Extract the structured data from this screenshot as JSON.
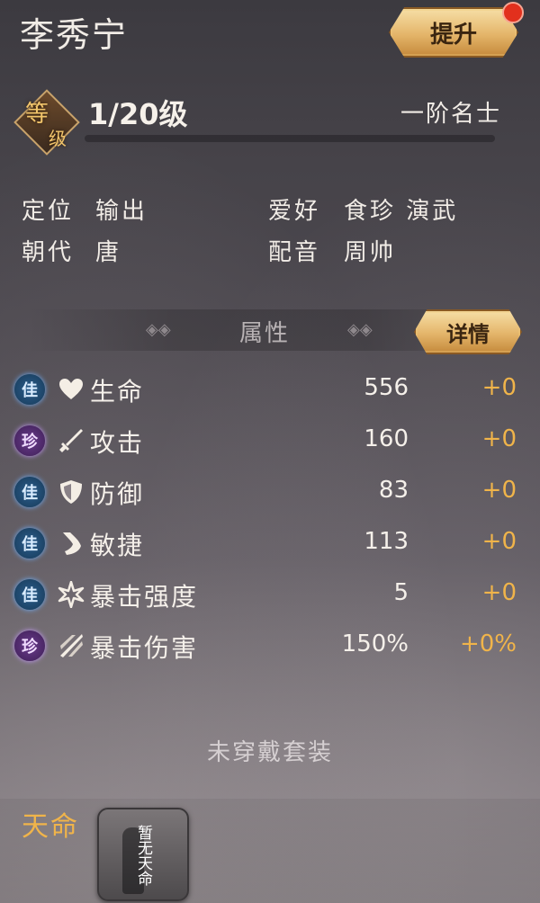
{
  "hero": {
    "name": "李秀宁",
    "upgrade_label": "提升"
  },
  "level": {
    "badge_top": "等",
    "badge_bottom": "级",
    "text": "1/20级",
    "rank": "一阶名士"
  },
  "info": {
    "role_label": "定位",
    "role_value": "输出",
    "hobby_label": "爱好",
    "hobby_value": "食珍 演武",
    "dynasty_label": "朝代",
    "dynasty_value": "唐",
    "voice_label": "配音",
    "voice_value": "周帅"
  },
  "attributes": {
    "title": "属性",
    "detail_label": "详情",
    "rows": [
      {
        "quality": "佳",
        "icon": "heart-icon",
        "name": "生命",
        "value": "556",
        "bonus": "+0"
      },
      {
        "quality": "珍",
        "icon": "sword-icon",
        "name": "攻击",
        "value": "160",
        "bonus": "+0"
      },
      {
        "quality": "佳",
        "icon": "shield-icon",
        "name": "防御",
        "value": "83",
        "bonus": "+0"
      },
      {
        "quality": "佳",
        "icon": "boot-icon",
        "name": "敏捷",
        "value": "113",
        "bonus": "+0"
      },
      {
        "quality": "佳",
        "icon": "star-burst-icon",
        "name": "暴击强度",
        "value": "5",
        "bonus": "+0"
      },
      {
        "quality": "珍",
        "icon": "slash-icon",
        "name": "暴击伤害",
        "value": "150%",
        "bonus": "+0%"
      }
    ]
  },
  "suit": {
    "status": "未穿戴套装"
  },
  "fate": {
    "label": "天命",
    "empty_text": "暂无天命"
  },
  "colors": {
    "gold": "#f0b44a",
    "jia_badge": "#2b5d8c",
    "zhen_badge": "#6a3b8c",
    "alert_dot": "#e2301d"
  }
}
